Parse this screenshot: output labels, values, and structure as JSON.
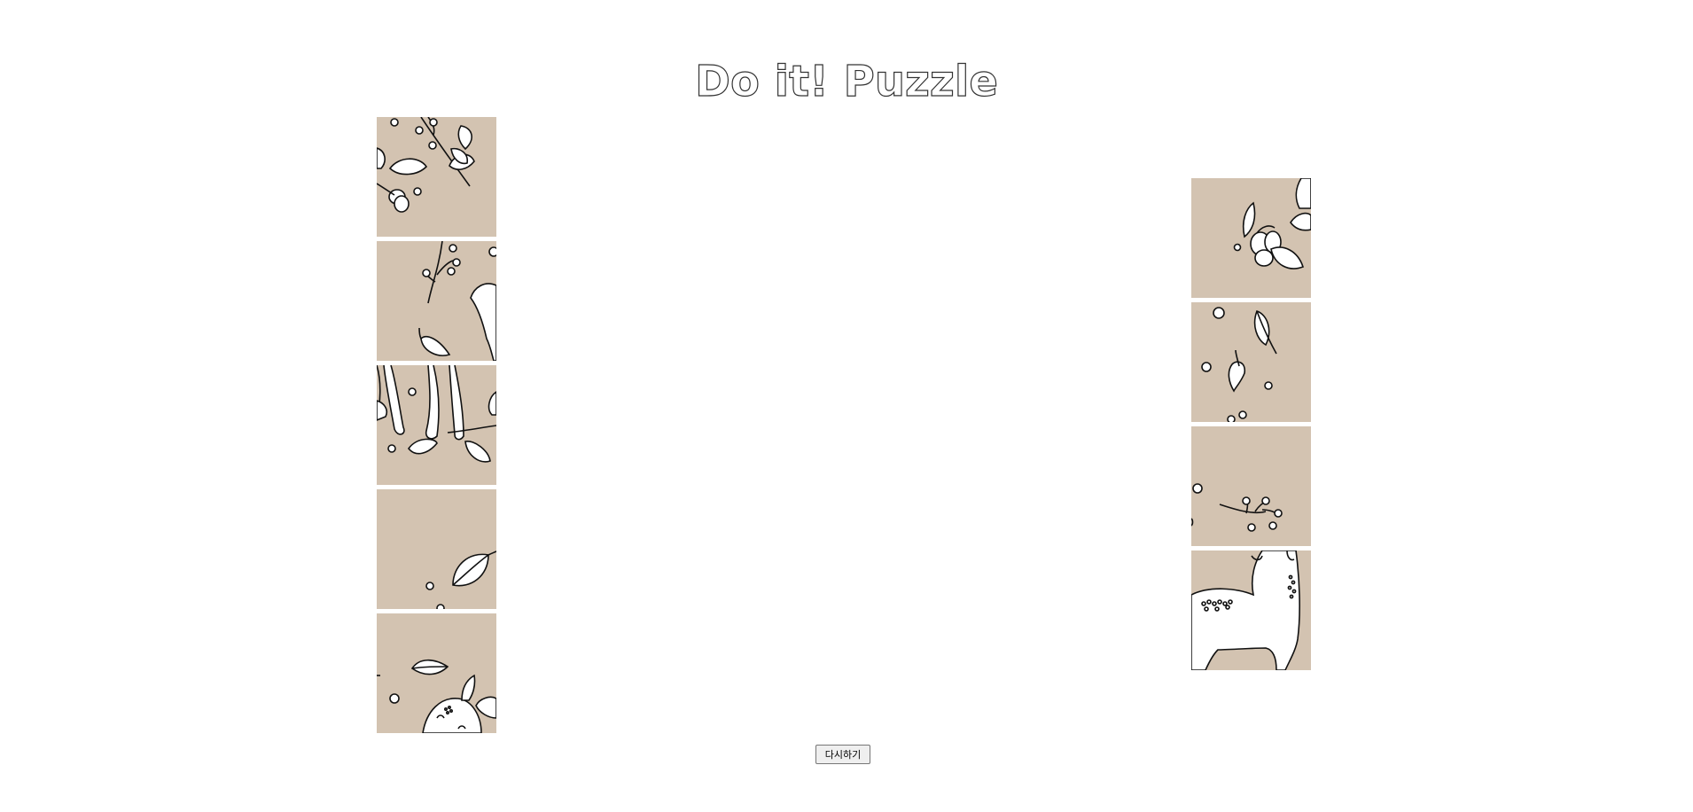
{
  "header": {
    "title": "Do it! Puzzle"
  },
  "controls": {
    "restart_label": "다시하기"
  },
  "colors": {
    "tile_background": "#d3c3b1",
    "line_art": "#111111"
  },
  "tiles_left": [
    {
      "name": "tile-branches-leaves-acorns"
    },
    {
      "name": "tile-twig-leaf-deer-back"
    },
    {
      "name": "tile-deer-legs-leaves"
    },
    {
      "name": "tile-single-leaf"
    },
    {
      "name": "tile-deer-head-leaf"
    }
  ],
  "tiles_right": [
    {
      "name": "tile-acorn-cluster"
    },
    {
      "name": "tile-two-leaves"
    },
    {
      "name": "tile-berry-sprig"
    },
    {
      "name": "tile-deer-body-spots"
    }
  ]
}
